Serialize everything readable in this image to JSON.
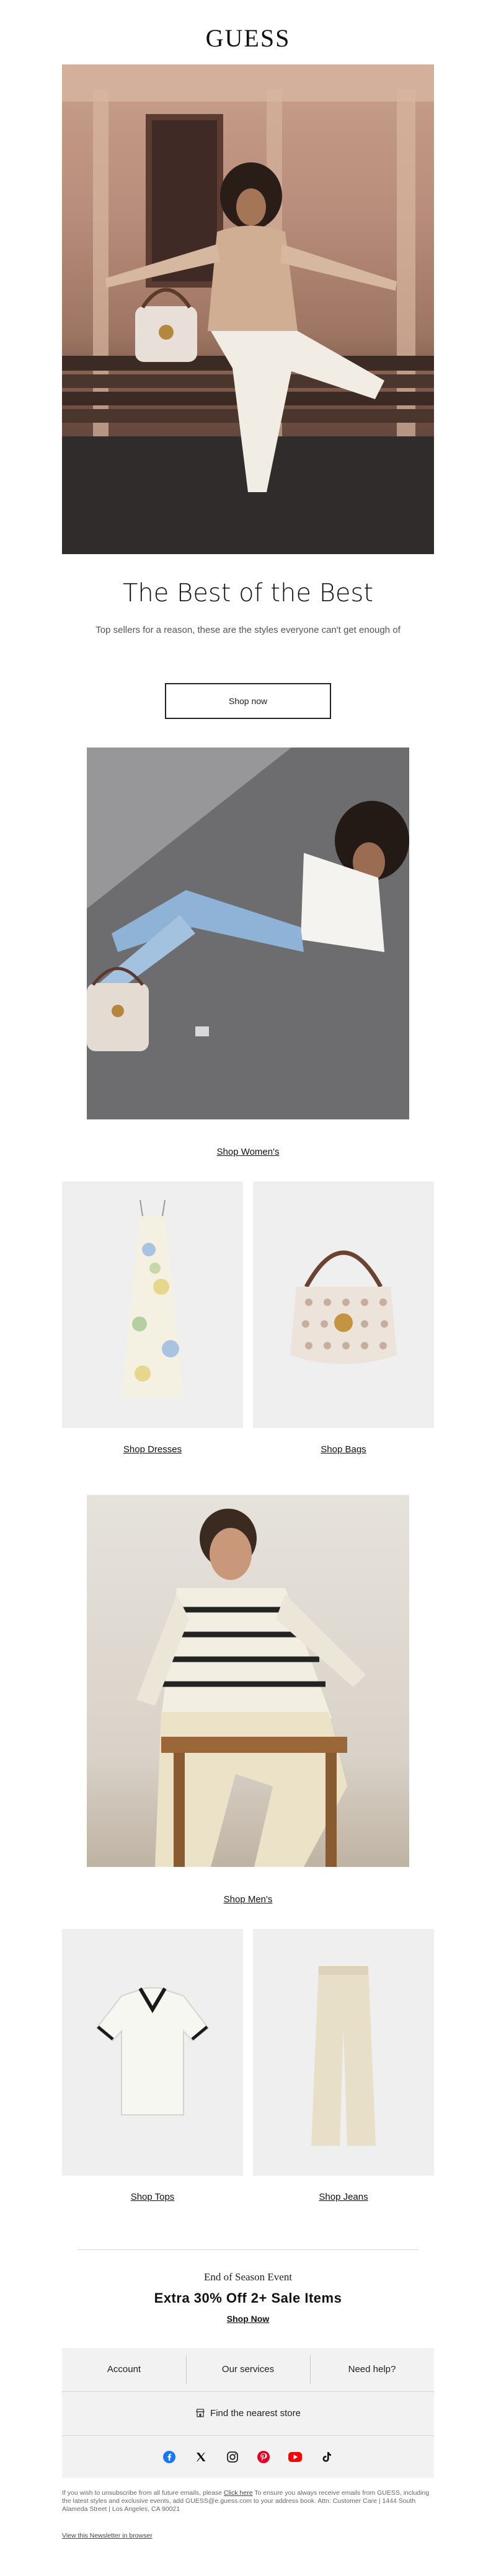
{
  "brand": {
    "logo_text": "GUESS"
  },
  "hero": {
    "headline": "The Best of the Best",
    "subtext": "Top sellers for a reason, these are the styles everyone can't get enough of",
    "button_label": "Shop now"
  },
  "sections": {
    "women": {
      "link_label": "Shop Women's"
    },
    "women_products": [
      {
        "link_label": "Shop Dresses"
      },
      {
        "link_label": "Shop Bags"
      }
    ],
    "men": {
      "link_label": "Shop Men's"
    },
    "men_products": [
      {
        "link_label": "Shop Tops"
      },
      {
        "link_label": "Shop Jeans"
      }
    ]
  },
  "promo": {
    "label": "End of Season Event",
    "title": "Extra 30% Off 2+ Sale Items",
    "link_label": "Shop Now"
  },
  "footer": {
    "nav": [
      "Account",
      "Our services",
      "Need help?"
    ],
    "store_label": "Find the nearest store",
    "social_icons": [
      "facebook-icon",
      "x-icon",
      "instagram-icon",
      "pinterest-icon",
      "youtube-icon",
      "tiktok-icon"
    ],
    "legal_before": "If you wish to unsubscribe from all future emails, please ",
    "legal_link": "Click here",
    "legal_after": " To ensure you always receive emails from GUESS, including the latest styles and exclusive events, add GUESS@e.guess.com to your address book. Attn: Customer Care | 1444 South Alameda Street | Los Angeles, CA 90021",
    "browser_link": "View this Newsletter in browser"
  },
  "colors": {
    "text": "#111111",
    "footer_bg": "#f2f2f2",
    "tile_bg": "#efefef"
  }
}
